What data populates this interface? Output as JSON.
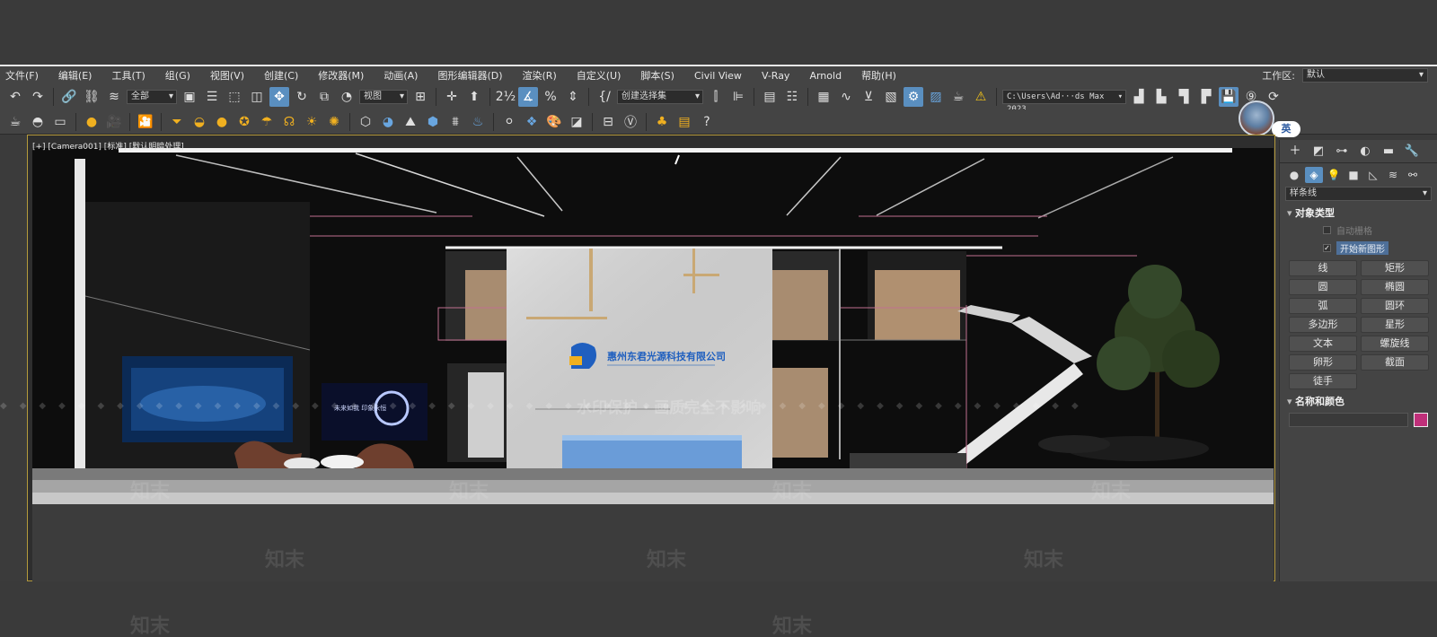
{
  "menu": [
    "文件(F)",
    "编辑(E)",
    "工具(T)",
    "组(G)",
    "视图(V)",
    "创建(C)",
    "修改器(M)",
    "动画(A)",
    "图形编辑器(D)",
    "渲染(R)",
    "自定义(U)",
    "脚本(S)",
    "Civil View",
    "V-Ray",
    "Arnold",
    "帮助(H)"
  ],
  "workspace": {
    "label": "工作区:",
    "value": "默认"
  },
  "toolbar": {
    "selection_filter": "全部",
    "ref_coord": "视图",
    "named_selection": "创建选择集",
    "project_path": "C:\\Users\\Ad···ds Max 2023"
  },
  "ime": {
    "label": "英"
  },
  "viewport": {
    "label": "[+] [Camera001] [标准] [默认明暗处理]",
    "sign_text": "惠州东君光源科技有限公司",
    "screen_text_1": "未来如我  印象永恒",
    "watermark_center": "水印保护 · 画质完全不影响",
    "watermark": "知末"
  },
  "panel": {
    "category": "样条线",
    "rollout_object_type": "对象类型",
    "auto_grid": "自动栅格",
    "start_new_shape": "开始新图形",
    "shapes": [
      "线",
      "矩形",
      "圆",
      "椭圆",
      "弧",
      "圆环",
      "多边形",
      "星形",
      "文本",
      "螺旋线",
      "卵形",
      "截面",
      "徒手"
    ],
    "rollout_name_color": "名称和颜色",
    "swatch_color": "#c0307a"
  },
  "icons": {
    "toolbar1": [
      "undo-icon",
      "redo-icon",
      "link-icon",
      "unlink-icon",
      "bind-space-warp-icon",
      "select-object-icon",
      "select-by-name-icon",
      "rect-region-icon",
      "window-crossing-icon",
      "move-icon",
      "rotate-icon",
      "scale-icon",
      "place-icon",
      "use-pivot-icon",
      "select-manipulate-icon",
      "snap-toggle-icon",
      "angle-snap-icon",
      "percent-snap-icon",
      "spinner-snap-icon",
      "edit-named-sets-icon",
      "mirror-icon",
      "align-icon",
      "scene-explorer-icon",
      "layer-explorer-icon",
      "toggle-ribbon-icon",
      "curve-editor-icon",
      "schematic-view-icon",
      "material-editor-icon",
      "render-setup-icon",
      "rendered-frame-icon",
      "render-production-icon",
      "render-iterative-icon",
      "warning-icon",
      "project-folder-icon",
      "set-project-icon",
      "save-icon",
      "counter-icon",
      "refresh-icon"
    ],
    "toolbar2": [
      "teapot-icon",
      "render-icon",
      "frame-buffer-icon",
      "vray-light-icon",
      "vray-camera-icon",
      "physical-camera-icon",
      "dome-light-icon",
      "sphere-light-icon",
      "sun-icon",
      "ies-icon",
      "mesh-light-icon",
      "sun-light-icon",
      "fur-icon",
      "proxy-icon",
      "vray-sphere-icon",
      "vray-plane-icon",
      "vray-fur-icon",
      "vray-fire-icon",
      "material-ball-icon",
      "material-lib-icon",
      "palette-icon",
      "swatch-icon",
      "scene-converter-icon",
      "vray-logo-icon",
      "tree-icon",
      "list-icon",
      "help-icon"
    ]
  }
}
